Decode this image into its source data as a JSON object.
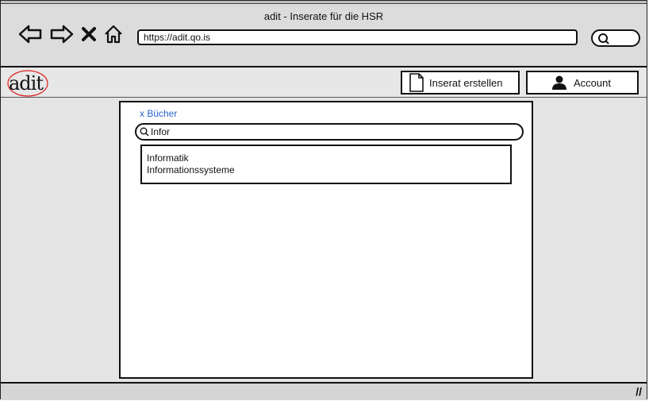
{
  "window": {
    "title": "adit - Inserate für die HSR"
  },
  "browser": {
    "url": "https://adit.qo.is",
    "icons": [
      "back-arrow-icon",
      "forward-arrow-icon",
      "close-icon",
      "home-icon",
      "search-icon"
    ]
  },
  "header": {
    "logo_text": "adit",
    "create_button_label": "Inserat erstellen",
    "account_button_label": "Account"
  },
  "main": {
    "filter_tag": "x Bücher",
    "search": {
      "value": "Infor"
    },
    "suggestions": [
      "Informatik",
      "Informationssysteme"
    ]
  },
  "statusbar": {
    "grip": "//"
  },
  "colors": {
    "link_blue": "#2a63c8",
    "chrome_gray": "#dcdcdc",
    "logo_ring_red": "#d22"
  }
}
